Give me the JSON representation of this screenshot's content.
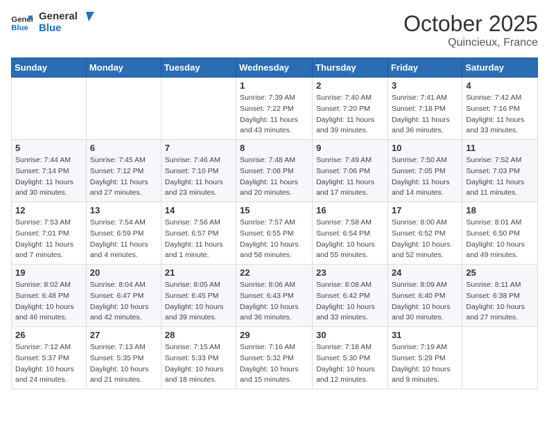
{
  "header": {
    "logo_line1": "General",
    "logo_line2": "Blue",
    "month_title": "October 2025",
    "location": "Quincieux, France"
  },
  "weekdays": [
    "Sunday",
    "Monday",
    "Tuesday",
    "Wednesday",
    "Thursday",
    "Friday",
    "Saturday"
  ],
  "weeks": [
    [
      {
        "day": "",
        "info": ""
      },
      {
        "day": "",
        "info": ""
      },
      {
        "day": "",
        "info": ""
      },
      {
        "day": "1",
        "info": "Sunrise: 7:39 AM\nSunset: 7:22 PM\nDaylight: 11 hours and 43 minutes."
      },
      {
        "day": "2",
        "info": "Sunrise: 7:40 AM\nSunset: 7:20 PM\nDaylight: 11 hours and 39 minutes."
      },
      {
        "day": "3",
        "info": "Sunrise: 7:41 AM\nSunset: 7:18 PM\nDaylight: 11 hours and 36 minutes."
      },
      {
        "day": "4",
        "info": "Sunrise: 7:42 AM\nSunset: 7:16 PM\nDaylight: 11 hours and 33 minutes."
      }
    ],
    [
      {
        "day": "5",
        "info": "Sunrise: 7:44 AM\nSunset: 7:14 PM\nDaylight: 11 hours and 30 minutes."
      },
      {
        "day": "6",
        "info": "Sunrise: 7:45 AM\nSunset: 7:12 PM\nDaylight: 11 hours and 27 minutes."
      },
      {
        "day": "7",
        "info": "Sunrise: 7:46 AM\nSunset: 7:10 PM\nDaylight: 11 hours and 23 minutes."
      },
      {
        "day": "8",
        "info": "Sunrise: 7:48 AM\nSunset: 7:08 PM\nDaylight: 11 hours and 20 minutes."
      },
      {
        "day": "9",
        "info": "Sunrise: 7:49 AM\nSunset: 7:06 PM\nDaylight: 11 hours and 17 minutes."
      },
      {
        "day": "10",
        "info": "Sunrise: 7:50 AM\nSunset: 7:05 PM\nDaylight: 11 hours and 14 minutes."
      },
      {
        "day": "11",
        "info": "Sunrise: 7:52 AM\nSunset: 7:03 PM\nDaylight: 11 hours and 11 minutes."
      }
    ],
    [
      {
        "day": "12",
        "info": "Sunrise: 7:53 AM\nSunset: 7:01 PM\nDaylight: 11 hours and 7 minutes."
      },
      {
        "day": "13",
        "info": "Sunrise: 7:54 AM\nSunset: 6:59 PM\nDaylight: 11 hours and 4 minutes."
      },
      {
        "day": "14",
        "info": "Sunrise: 7:56 AM\nSunset: 6:57 PM\nDaylight: 11 hours and 1 minute."
      },
      {
        "day": "15",
        "info": "Sunrise: 7:57 AM\nSunset: 6:55 PM\nDaylight: 10 hours and 58 minutes."
      },
      {
        "day": "16",
        "info": "Sunrise: 7:58 AM\nSunset: 6:54 PM\nDaylight: 10 hours and 55 minutes."
      },
      {
        "day": "17",
        "info": "Sunrise: 8:00 AM\nSunset: 6:52 PM\nDaylight: 10 hours and 52 minutes."
      },
      {
        "day": "18",
        "info": "Sunrise: 8:01 AM\nSunset: 6:50 PM\nDaylight: 10 hours and 49 minutes."
      }
    ],
    [
      {
        "day": "19",
        "info": "Sunrise: 8:02 AM\nSunset: 6:48 PM\nDaylight: 10 hours and 46 minutes."
      },
      {
        "day": "20",
        "info": "Sunrise: 8:04 AM\nSunset: 6:47 PM\nDaylight: 10 hours and 42 minutes."
      },
      {
        "day": "21",
        "info": "Sunrise: 8:05 AM\nSunset: 6:45 PM\nDaylight: 10 hours and 39 minutes."
      },
      {
        "day": "22",
        "info": "Sunrise: 8:06 AM\nSunset: 6:43 PM\nDaylight: 10 hours and 36 minutes."
      },
      {
        "day": "23",
        "info": "Sunrise: 8:08 AM\nSunset: 6:42 PM\nDaylight: 10 hours and 33 minutes."
      },
      {
        "day": "24",
        "info": "Sunrise: 8:09 AM\nSunset: 6:40 PM\nDaylight: 10 hours and 30 minutes."
      },
      {
        "day": "25",
        "info": "Sunrise: 8:11 AM\nSunset: 6:38 PM\nDaylight: 10 hours and 27 minutes."
      }
    ],
    [
      {
        "day": "26",
        "info": "Sunrise: 7:12 AM\nSunset: 5:37 PM\nDaylight: 10 hours and 24 minutes."
      },
      {
        "day": "27",
        "info": "Sunrise: 7:13 AM\nSunset: 5:35 PM\nDaylight: 10 hours and 21 minutes."
      },
      {
        "day": "28",
        "info": "Sunrise: 7:15 AM\nSunset: 5:33 PM\nDaylight: 10 hours and 18 minutes."
      },
      {
        "day": "29",
        "info": "Sunrise: 7:16 AM\nSunset: 5:32 PM\nDaylight: 10 hours and 15 minutes."
      },
      {
        "day": "30",
        "info": "Sunrise: 7:18 AM\nSunset: 5:30 PM\nDaylight: 10 hours and 12 minutes."
      },
      {
        "day": "31",
        "info": "Sunrise: 7:19 AM\nSunset: 5:29 PM\nDaylight: 10 hours and 9 minutes."
      },
      {
        "day": "",
        "info": ""
      }
    ]
  ]
}
